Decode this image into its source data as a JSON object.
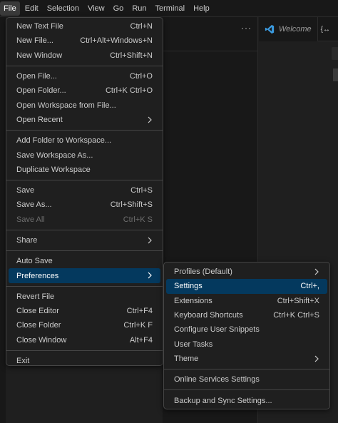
{
  "menubar": {
    "items": [
      "File",
      "Edit",
      "Selection",
      "View",
      "Go",
      "Run",
      "Terminal",
      "Help"
    ],
    "active": 0
  },
  "panel": {
    "more_actions": "···"
  },
  "editor": {
    "tab_welcome": "Welcome",
    "tab_partial": "{↔"
  },
  "file_menu": {
    "groups": [
      [
        {
          "label": "New Text File",
          "shortcut": "Ctrl+N"
        },
        {
          "label": "New File...",
          "shortcut": "Ctrl+Alt+Windows+N"
        },
        {
          "label": "New Window",
          "shortcut": "Ctrl+Shift+N"
        }
      ],
      [
        {
          "label": "Open File...",
          "shortcut": "Ctrl+O"
        },
        {
          "label": "Open Folder...",
          "shortcut": "Ctrl+K Ctrl+O"
        },
        {
          "label": "Open Workspace from File...",
          "shortcut": ""
        },
        {
          "label": "Open Recent",
          "shortcut": "",
          "submenu": true
        }
      ],
      [
        {
          "label": "Add Folder to Workspace...",
          "shortcut": ""
        },
        {
          "label": "Save Workspace As...",
          "shortcut": ""
        },
        {
          "label": "Duplicate Workspace",
          "shortcut": ""
        }
      ],
      [
        {
          "label": "Save",
          "shortcut": "Ctrl+S"
        },
        {
          "label": "Save As...",
          "shortcut": "Ctrl+Shift+S"
        },
        {
          "label": "Save All",
          "shortcut": "Ctrl+K S",
          "disabled": true
        }
      ],
      [
        {
          "label": "Share",
          "shortcut": "",
          "submenu": true
        }
      ],
      [
        {
          "label": "Auto Save",
          "shortcut": ""
        },
        {
          "label": "Preferences",
          "shortcut": "",
          "submenu": true,
          "highlighted": true
        }
      ],
      [
        {
          "label": "Revert File",
          "shortcut": ""
        },
        {
          "label": "Close Editor",
          "shortcut": "Ctrl+F4"
        },
        {
          "label": "Close Folder",
          "shortcut": "Ctrl+K F"
        },
        {
          "label": "Close Window",
          "shortcut": "Alt+F4"
        }
      ],
      [
        {
          "label": "Exit",
          "shortcut": ""
        }
      ]
    ]
  },
  "preferences_submenu": {
    "groups": [
      [
        {
          "label": "Profiles (Default)",
          "shortcut": "",
          "submenu": true
        },
        {
          "label": "Settings",
          "shortcut": "Ctrl+,",
          "highlighted": true
        },
        {
          "label": "Extensions",
          "shortcut": "Ctrl+Shift+X"
        },
        {
          "label": "Keyboard Shortcuts",
          "shortcut": "Ctrl+K Ctrl+S"
        },
        {
          "label": "Configure User Snippets",
          "shortcut": ""
        },
        {
          "label": "User Tasks",
          "shortcut": ""
        },
        {
          "label": "Theme",
          "shortcut": "",
          "submenu": true
        }
      ],
      [
        {
          "label": "Online Services Settings",
          "shortcut": ""
        }
      ],
      [
        {
          "label": "Backup and Sync Settings...",
          "shortcut": ""
        }
      ]
    ]
  },
  "colors": {
    "highlight": "#04395e",
    "vscode_blue": "#3b9be0"
  },
  "icons": {
    "submenu": "chevron-right-icon",
    "tab": "vscode-logo-icon"
  }
}
